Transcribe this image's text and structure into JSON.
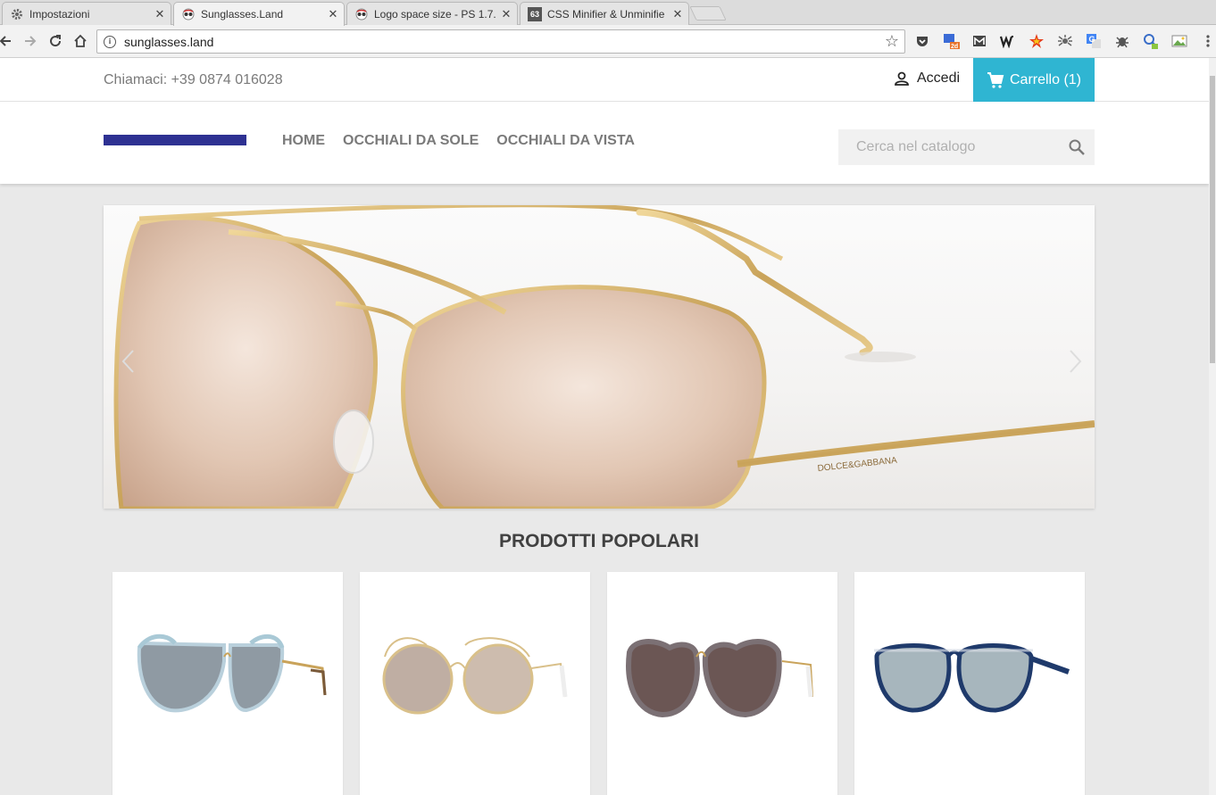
{
  "browser": {
    "tabs": [
      {
        "title": "Impostazioni",
        "icon": "gear-icon"
      },
      {
        "title": "Sunglasses.Land",
        "icon": "site-favicon"
      },
      {
        "title": "Logo space size - PS 1.7.",
        "icon": "site-favicon"
      },
      {
        "title": "CSS Minifier & Unminifie",
        "icon": "css-favicon",
        "icon_text": "63"
      }
    ],
    "url": "sunglasses.land",
    "extensions": [
      "pocket-icon",
      "translate-badge-icon",
      "gmail-icon",
      "wordpress-icon",
      "star-icon",
      "spider-icon",
      "google-translate-icon",
      "bug-icon",
      "magnifier-icon",
      "image-icon"
    ],
    "ext_badge": "2d"
  },
  "shop": {
    "phone": "Chiamaci: +39 0874 016028",
    "signin": "Accedi",
    "cart": "Carrello (1)",
    "menu": [
      "HOME",
      "OCCHIALI DA SOLE",
      "OCCHIALI DA VISTA"
    ],
    "search_placeholder": "Cerca nel catalogo",
    "section_title": "PRODOTTI POPOLARI",
    "slide_brand": "DOLCE&GABBANA",
    "logo_color": "#2e3192",
    "accent_color": "#2fb5d2",
    "products": [
      {
        "name": "cat-eye-blue-sunglasses"
      },
      {
        "name": "gold-wire-round-sunglasses"
      },
      {
        "name": "tortoise-cat-eye-sunglasses"
      },
      {
        "name": "blue-round-sunglasses"
      }
    ]
  }
}
